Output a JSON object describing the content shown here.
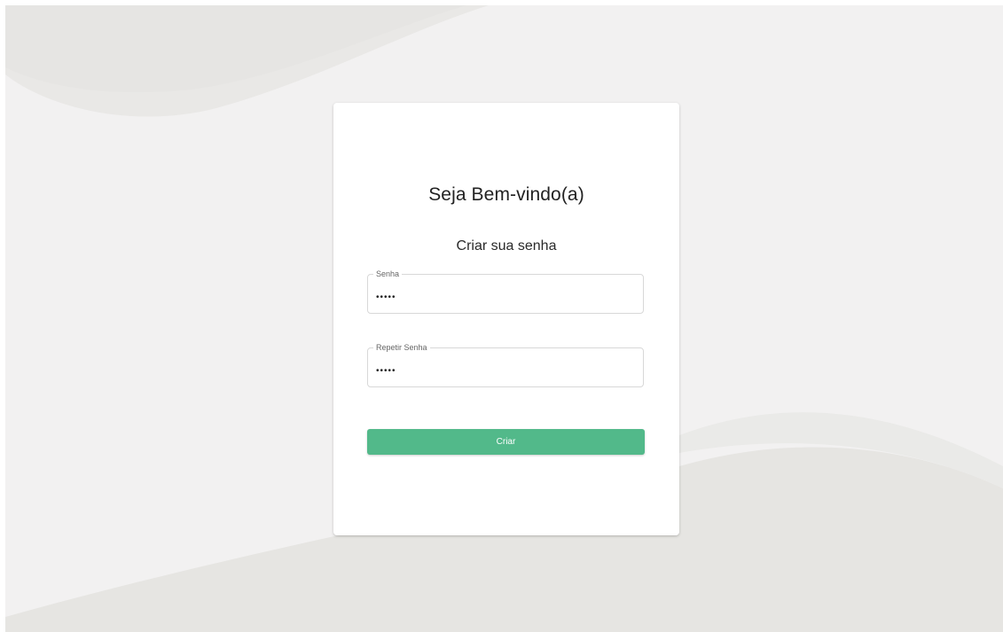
{
  "header": {
    "title": "Seja Bem-vindo(a)",
    "subtitle": "Criar sua senha"
  },
  "form": {
    "password": {
      "label": "Senha",
      "value": "•••••"
    },
    "repeat_password": {
      "label": "Repetir Senha",
      "value": "•••••"
    },
    "submit_label": "Criar"
  },
  "colors": {
    "background": "#f2f1f1",
    "wave": "#e6e5e3",
    "card": "#ffffff",
    "primary": "#52b98a",
    "field_border": "#d8d8d8"
  }
}
